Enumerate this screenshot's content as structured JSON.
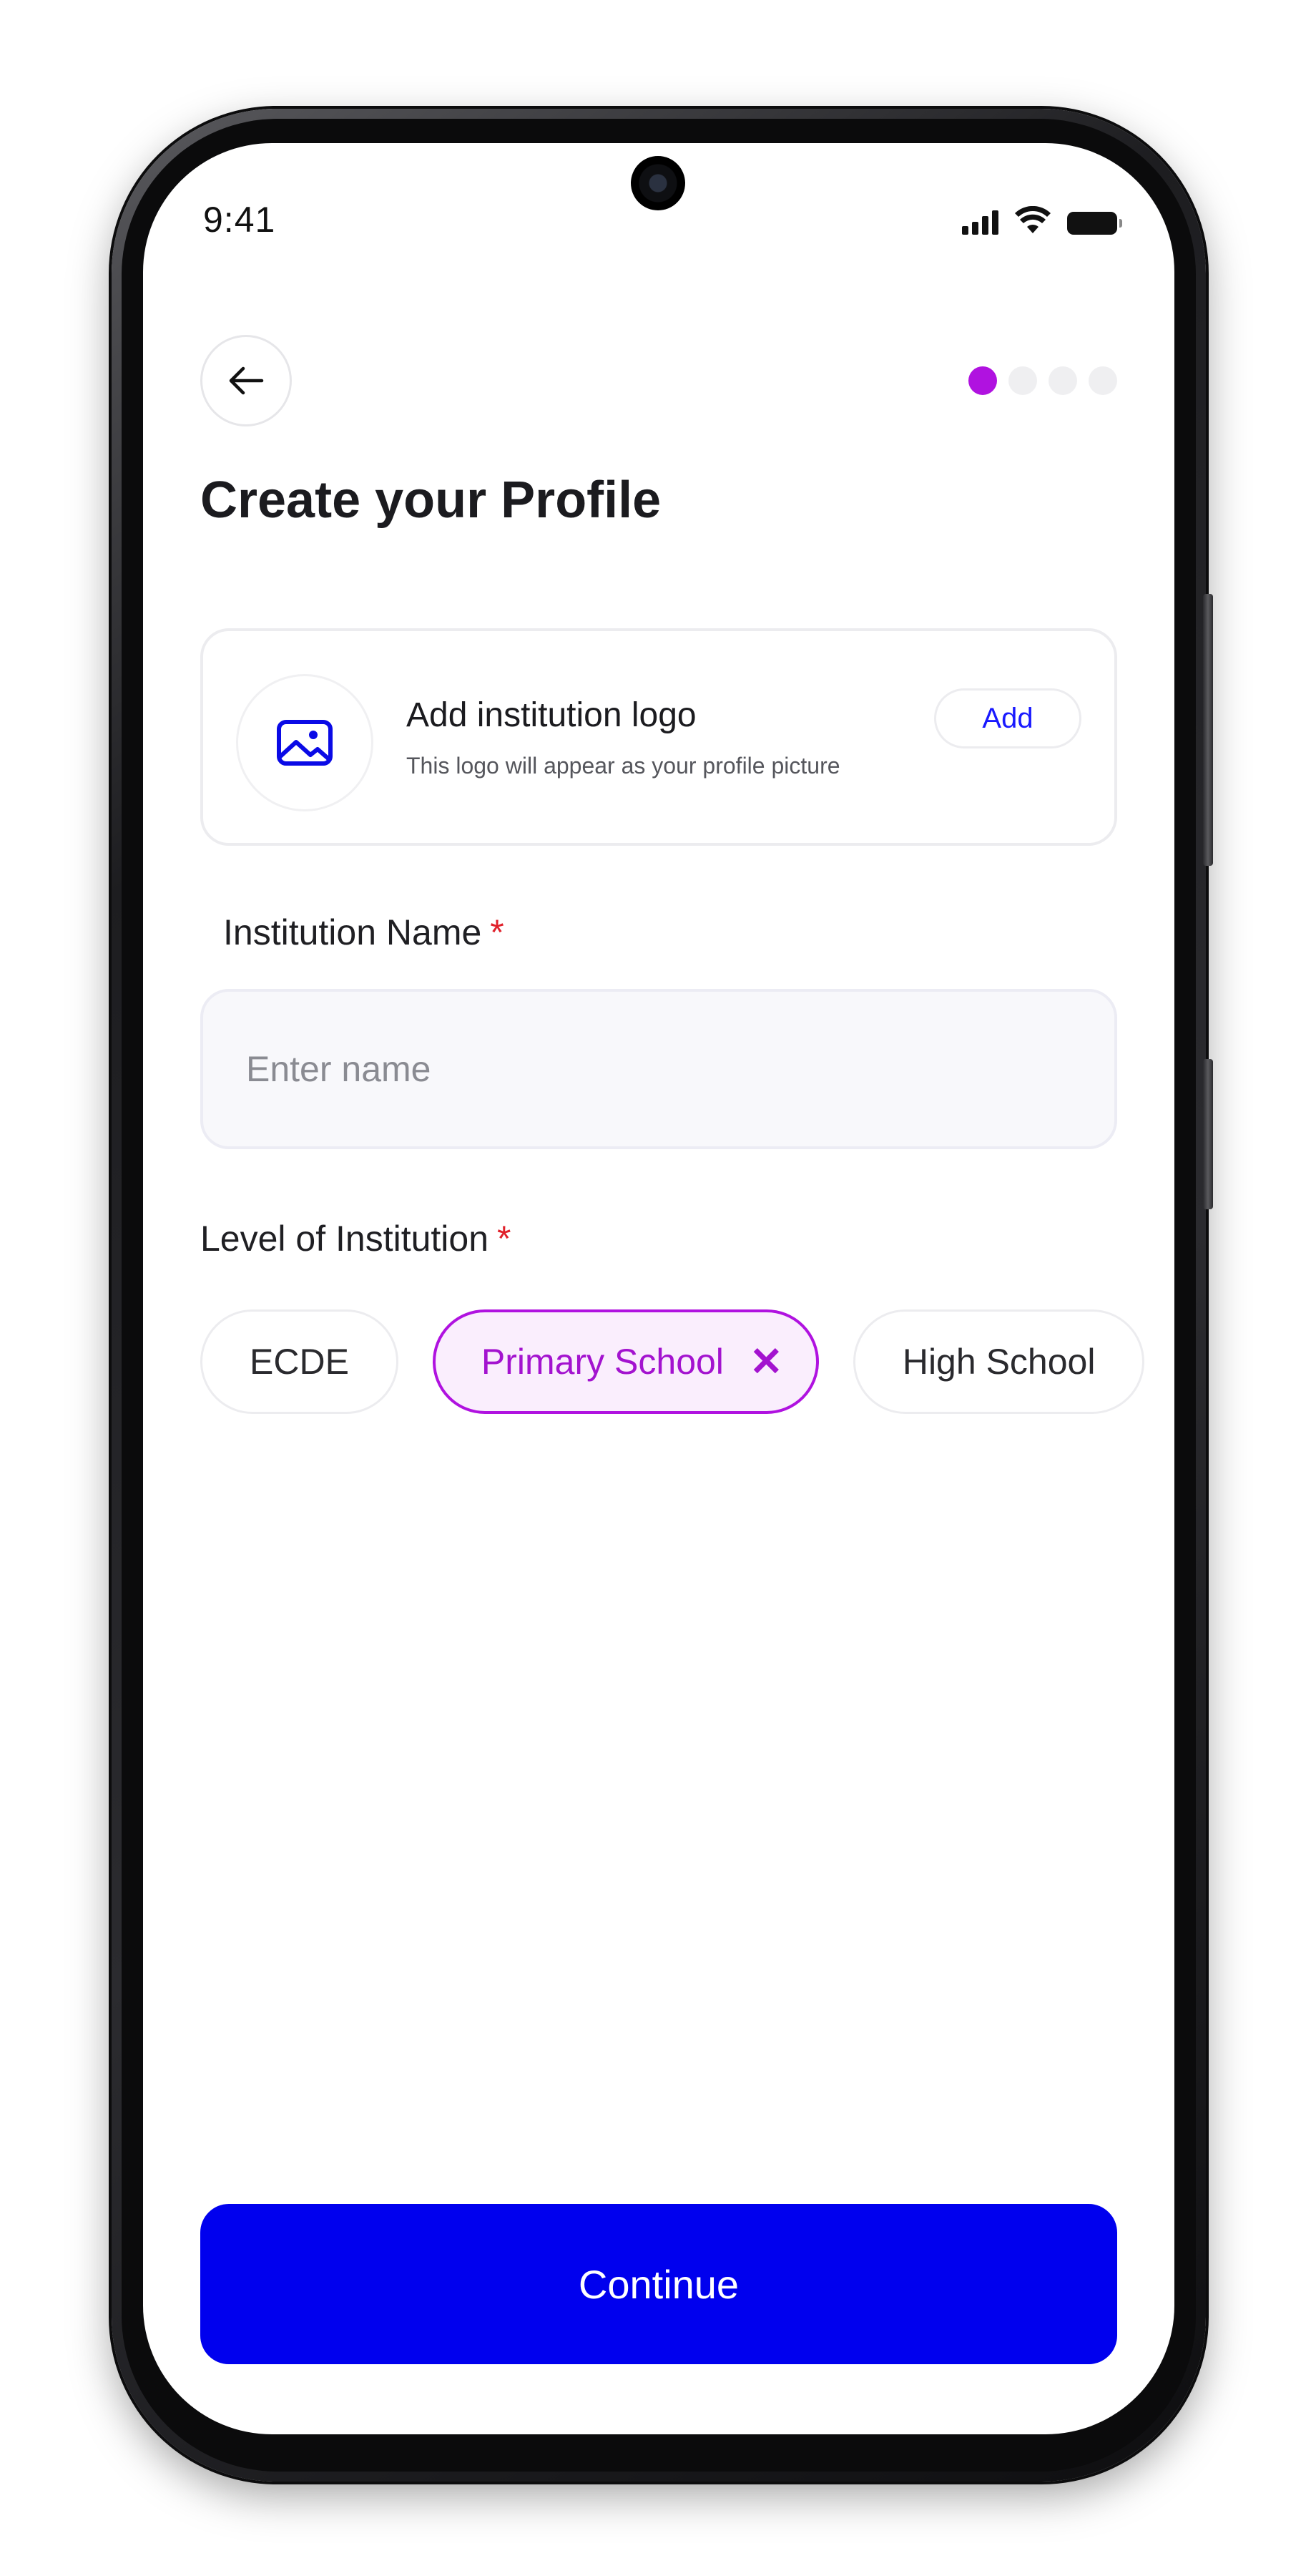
{
  "status_bar": {
    "time": "9:41"
  },
  "header": {
    "back_icon": "arrow-left-icon",
    "steps_total": 4,
    "step_current": 1
  },
  "title": "Create your Profile",
  "logo_card": {
    "icon": "image-icon",
    "title": "Add institution logo",
    "subtitle": "This logo will appear as your profile picture",
    "add_label": "Add"
  },
  "institution_name": {
    "label": "Institution Name",
    "required_mark": "*",
    "placeholder": "Enter name",
    "value": ""
  },
  "level": {
    "label": "Level of Institution",
    "required_mark": "*",
    "options": [
      {
        "label": "ECDE",
        "selected": false
      },
      {
        "label": "Primary School",
        "selected": true,
        "remove_glyph": "✕"
      },
      {
        "label": "High School",
        "selected": false
      }
    ]
  },
  "continue_label": "Continue",
  "colors": {
    "accent_purple": "#b012e0",
    "primary_blue": "#0000ee",
    "required_red": "#e0202a",
    "link_blue": "#1a1aff"
  }
}
